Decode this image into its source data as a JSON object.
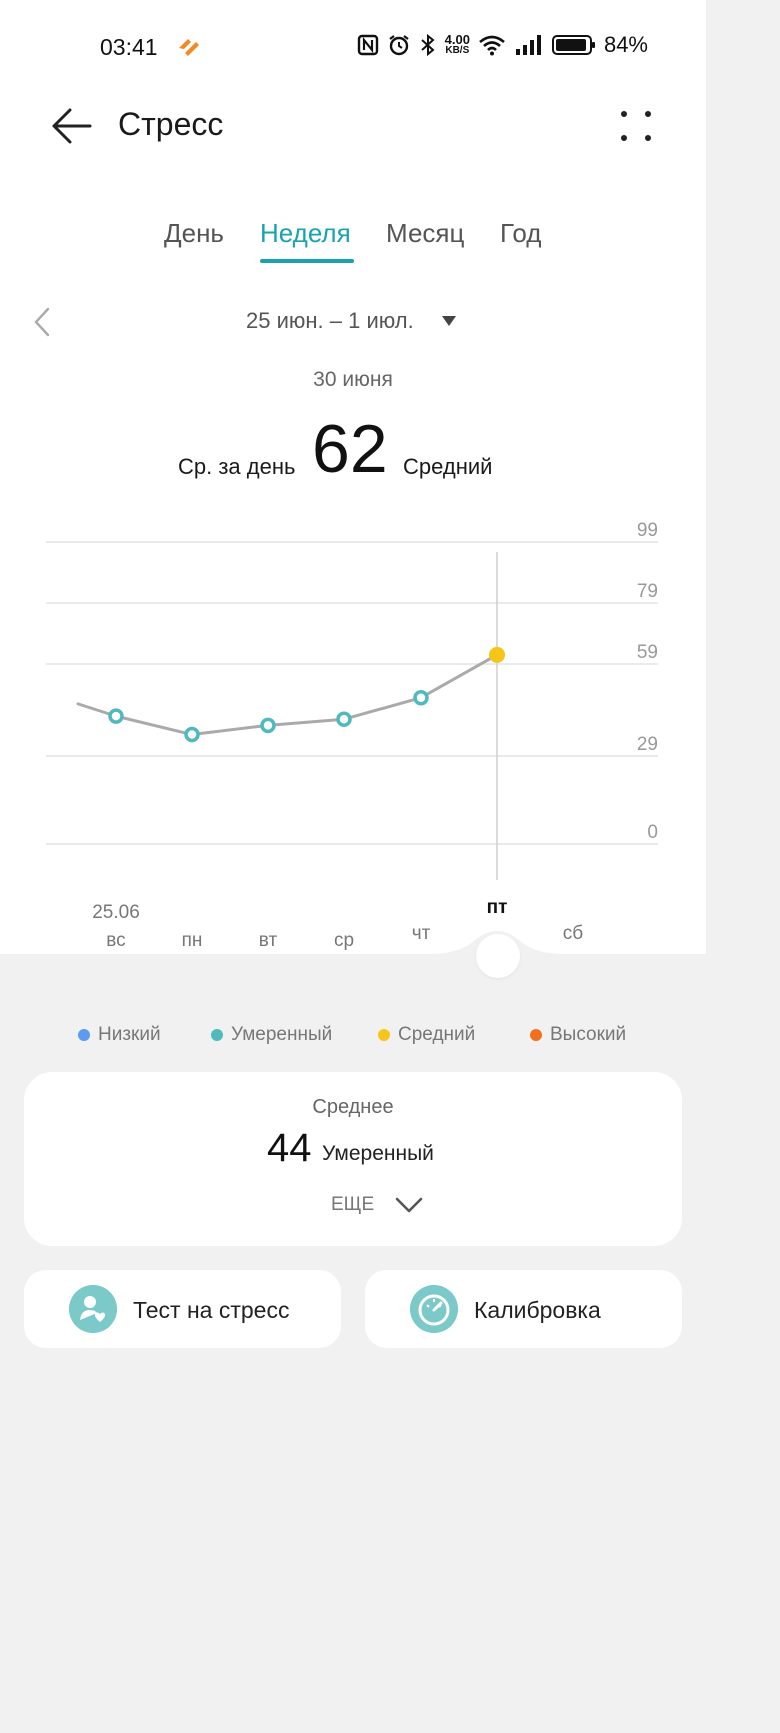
{
  "status_bar": {
    "time": "03:41",
    "net_speed_value": "4.00",
    "net_speed_unit": "KB/S",
    "battery": "84%"
  },
  "header": {
    "title": "Стресс"
  },
  "tabs": [
    {
      "label": "День",
      "active": false
    },
    {
      "label": "Неделя",
      "active": true
    },
    {
      "label": "Месяц",
      "active": false
    },
    {
      "label": "Год",
      "active": false
    }
  ],
  "range": {
    "label": "25 июн. – 1 июл."
  },
  "selected": {
    "date": "30 июня",
    "prefix": "Ср. за день",
    "value": "62",
    "state": "Средний"
  },
  "chart_data": {
    "type": "line",
    "categories": [
      "вс",
      "пн",
      "вт",
      "ср",
      "чт",
      "пт",
      "сб"
    ],
    "first_date_label": "25.06",
    "selected_category": "пт",
    "y_ticks": [
      99,
      79,
      59,
      29,
      0
    ],
    "ylim": [
      0,
      99
    ],
    "grid": true,
    "values": [
      42,
      36,
      39,
      41,
      48,
      62,
      null
    ],
    "lead_in_value": 46,
    "colors": {
      "line": "#aaaaaa",
      "moderate": "#4fb9bd",
      "average": "#f5c518"
    }
  },
  "legend": [
    {
      "label": "Низкий",
      "color": "#5b9bf0"
    },
    {
      "label": "Умеренный",
      "color": "#4fb9bd"
    },
    {
      "label": "Средний",
      "color": "#f5c518"
    },
    {
      "label": "Высокий",
      "color": "#f07020"
    }
  ],
  "summary": {
    "label": "Среднее",
    "value": "44",
    "state": "Умеренный",
    "more": "ЕЩЕ"
  },
  "actions": {
    "stress_test": "Тест на стресс",
    "calibration": "Калибровка"
  },
  "accent": "#1aa3ad"
}
